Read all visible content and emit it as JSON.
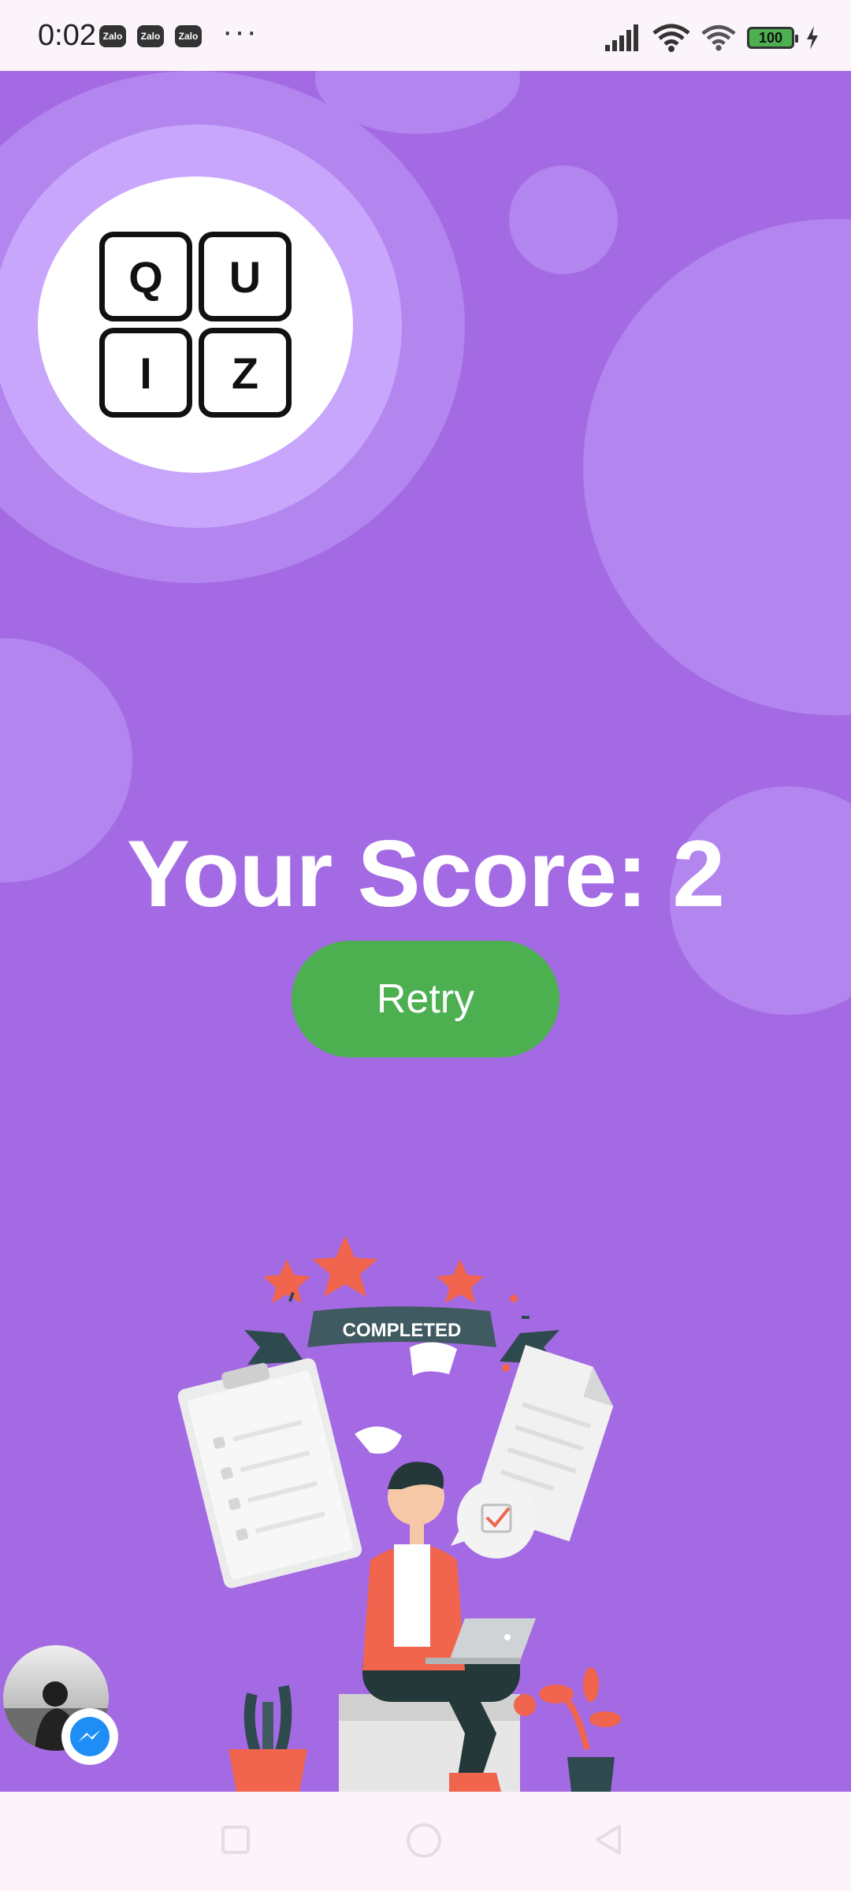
{
  "status_bar": {
    "time": "0:02",
    "notification_icons": [
      "Zalo",
      "Zalo",
      "Zalo"
    ],
    "more": "···",
    "battery": "100"
  },
  "logo": {
    "letters": [
      "Q",
      "U",
      "I",
      "Z"
    ]
  },
  "score": {
    "text": "Your Score: 2"
  },
  "retry_button": {
    "label": "Retry"
  },
  "illustration": {
    "banner_text": "COMPLETED"
  },
  "icons": {
    "signal": "signal-icon",
    "wifi": "wifi-icon",
    "charging": "charging-icon",
    "messenger": "messenger-icon"
  },
  "colors": {
    "background": "#a46ae3",
    "retry": "#4caf50",
    "score_text": "#ffffff"
  }
}
